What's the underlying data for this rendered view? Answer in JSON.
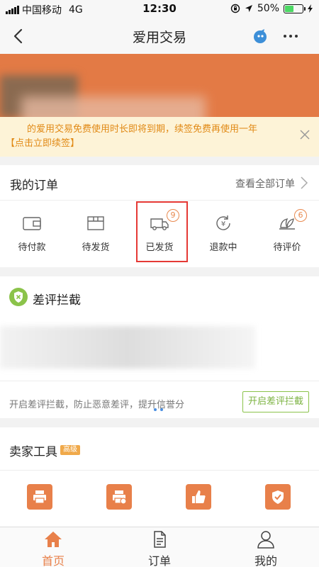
{
  "status": {
    "carrier": "中国移动",
    "network": "4G",
    "time": "12:30",
    "battery": "50%",
    "battery_level": 50
  },
  "nav": {
    "title": "爱用交易"
  },
  "notice": {
    "text": "的爱用交易免费使用时长即将到期，续签免费再使用一年",
    "link": "【点击立即续签】"
  },
  "orders": {
    "title": "我的订单",
    "view_all": "查看全部订单",
    "items": [
      {
        "label": "待付款",
        "icon": "wallet-icon"
      },
      {
        "label": "待发货",
        "icon": "package-icon"
      },
      {
        "label": "已发货",
        "icon": "truck-icon",
        "badge": "9"
      },
      {
        "label": "退款中",
        "icon": "refund-icon"
      },
      {
        "label": "待评价",
        "icon": "review-icon",
        "badge": "6"
      }
    ]
  },
  "bad_review": {
    "title": "差评拦截",
    "description": "开启差评拦截，防止恶意差评，提升信誉分",
    "button": "开启差评拦截"
  },
  "tools": {
    "title": "卖家工具",
    "tag": "高级",
    "items": [
      {
        "icon": "printer-icon"
      },
      {
        "icon": "auto-print-icon"
      },
      {
        "icon": "thumbs-up-icon"
      },
      {
        "icon": "shield-check-icon"
      }
    ]
  },
  "tabs": [
    {
      "label": "首页",
      "icon": "home-icon",
      "active": true
    },
    {
      "label": "订单",
      "icon": "document-icon",
      "active": false
    },
    {
      "label": "我的",
      "icon": "user-icon",
      "active": false
    }
  ],
  "colors": {
    "accent": "#e8804a",
    "badge": "#e8894f",
    "green": "#7cb342",
    "highlight": "#e53935"
  }
}
